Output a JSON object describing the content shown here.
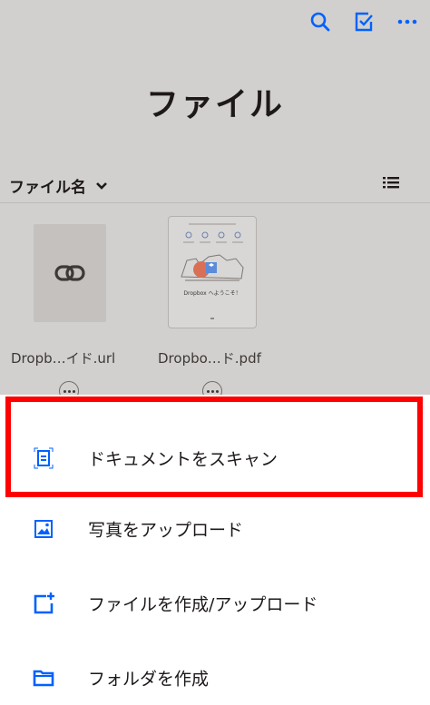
{
  "header": {
    "title": "ファイル",
    "actions": [
      {
        "name": "search-icon",
        "color": "#0061fe"
      },
      {
        "name": "select-checkbox-icon",
        "color": "#0061fe"
      },
      {
        "name": "more-horizontal-icon",
        "color": "#0061fe"
      }
    ]
  },
  "sort": {
    "label": "ファイル名",
    "caret_icon": "chevron-down-icon",
    "view_icon": "list-view-icon"
  },
  "files": [
    {
      "name": "Dropb…イド.url",
      "thumb_icon": "link-icon"
    },
    {
      "name": "Dropbo…ド.pdf",
      "thumb_caption": "Dropbox へようこそ！"
    }
  ],
  "menu": {
    "items": [
      {
        "label": "ドキュメントをスキャン",
        "icon": "document-scan-icon"
      },
      {
        "label": "写真をアップロード",
        "icon": "photo-upload-icon"
      },
      {
        "label": "ファイルを作成/アップロード",
        "icon": "file-create-icon"
      },
      {
        "label": "フォルダを作成",
        "icon": "folder-icon"
      }
    ]
  },
  "colors": {
    "accent": "#0061fe",
    "highlight": "#ff0000",
    "dim_background": "#d2d0ce"
  }
}
